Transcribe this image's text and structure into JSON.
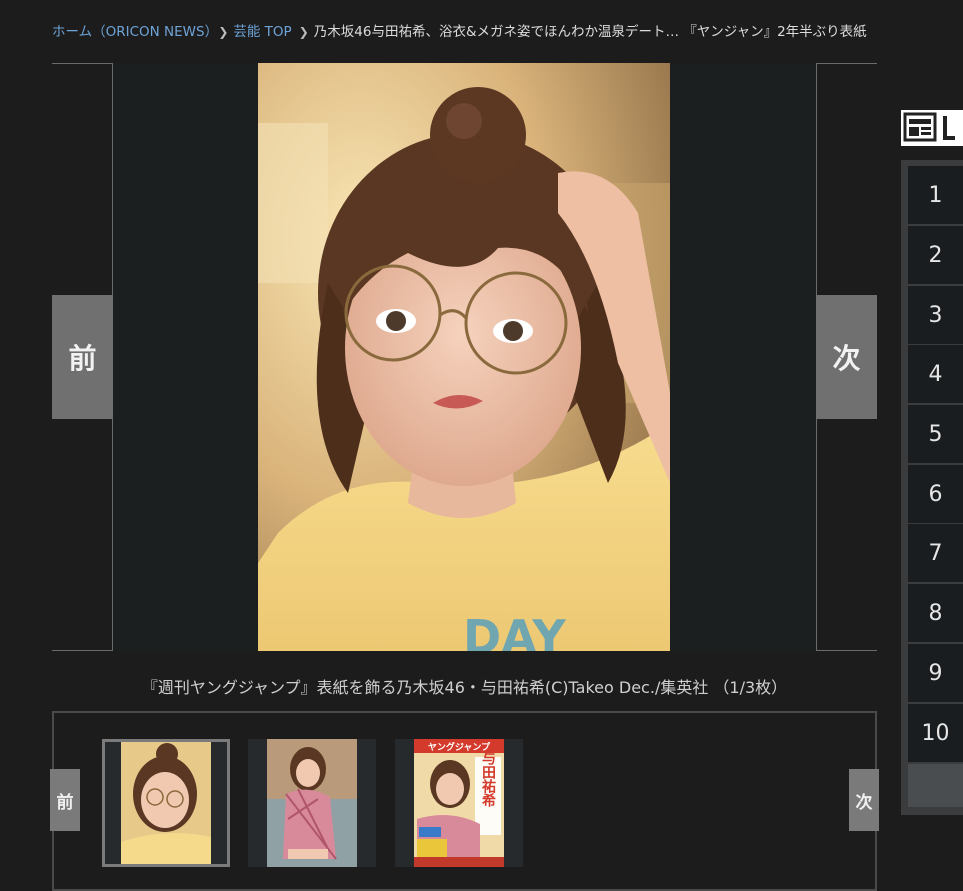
{
  "breadcrumb": {
    "home": "ホーム（ORICON NEWS）",
    "section": "芸能 TOP",
    "current": "乃木坂46与田祐希、浴衣&メガネ姿でほんわか温泉デート… 『ヤンジャン』2年半ぶり表紙"
  },
  "viewer": {
    "prev_label": "前",
    "next_label": "次",
    "photo_print_text": "DAY"
  },
  "caption": "『週刊ヤングジャンプ』表紙を飾る乃木坂46・与田祐希(C)Takeo Dec./集英社 （1/3枚）",
  "thumbnails": {
    "prev_label": "前",
    "next_label": "次",
    "items": [
      {
        "index": 1,
        "active": true
      },
      {
        "index": 2,
        "active": false
      },
      {
        "index": 3,
        "active": false
      }
    ],
    "cover_title_text": "ヤングジャンプ",
    "cover_name_text": "与田祐希"
  },
  "ranking": {
    "header_icon": "newspaper-icon",
    "items": [
      "1",
      "2",
      "3",
      "4",
      "5",
      "6",
      "7",
      "8",
      "9",
      "10"
    ]
  },
  "colors": {
    "link": "#6ea3d6",
    "background": "#1c1c1d",
    "nav_button": "#707070"
  }
}
